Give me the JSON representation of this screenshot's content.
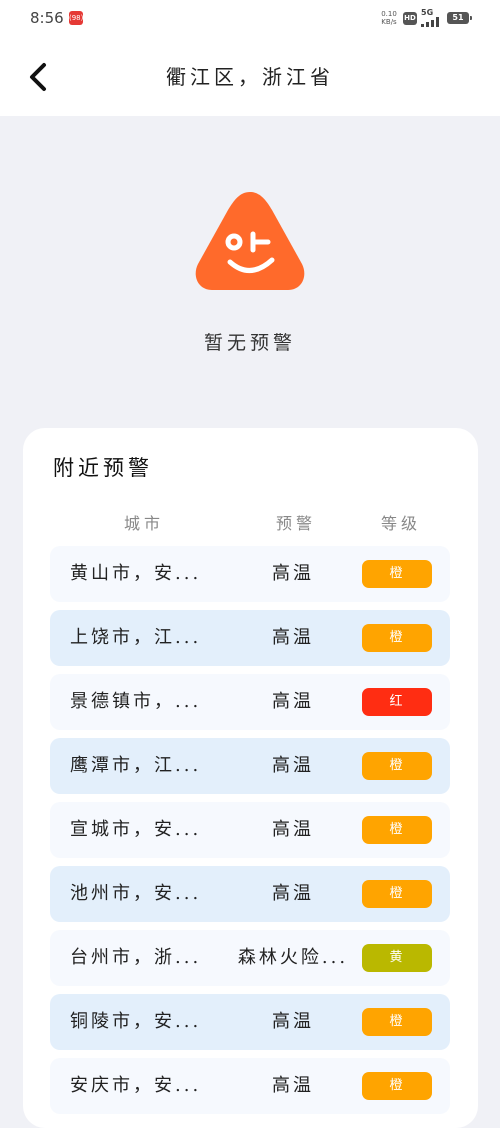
{
  "status_bar": {
    "time": "8:56",
    "badge": "(98)",
    "net_speed_value": "0.10",
    "net_speed_unit": "KB/s",
    "hd": "HD",
    "network": "5G",
    "battery": "51"
  },
  "header": {
    "back_icon": "chevron-left-icon",
    "title": "衢江区，浙江省"
  },
  "hero": {
    "icon": "smiling-triangle-icon",
    "icon_color": "#ff6a2b",
    "message": "暂无预警"
  },
  "nearby": {
    "title": "附近预警",
    "columns": {
      "city": "城市",
      "alert": "预警",
      "level": "等级"
    },
    "rows": [
      {
        "city": "黄山市，安...",
        "alert": "高温",
        "level": "橙",
        "level_color": "#ffa400"
      },
      {
        "city": "上饶市，江...",
        "alert": "高温",
        "level": "橙",
        "level_color": "#ffa400"
      },
      {
        "city": "景德镇市，...",
        "alert": "高温",
        "level": "红",
        "level_color": "#ff2d12"
      },
      {
        "city": "鹰潭市，江...",
        "alert": "高温",
        "level": "橙",
        "level_color": "#ffa400"
      },
      {
        "city": "宣城市，安...",
        "alert": "高温",
        "level": "橙",
        "level_color": "#ffa400"
      },
      {
        "city": "池州市，安...",
        "alert": "高温",
        "level": "橙",
        "level_color": "#ffa400"
      },
      {
        "city": "台州市，浙...",
        "alert": "森林火险...",
        "level": "黄",
        "level_color": "#bab800"
      },
      {
        "city": "铜陵市，安...",
        "alert": "高温",
        "level": "橙",
        "level_color": "#ffa400"
      },
      {
        "city": "安庆市，安...",
        "alert": "高温",
        "level": "橙",
        "level_color": "#ffa400"
      }
    ]
  }
}
